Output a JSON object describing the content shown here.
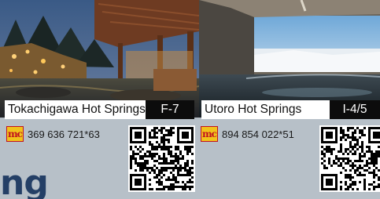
{
  "cards": [
    {
      "name": "Tokachigawa Hot Springs",
      "code": "F-7",
      "mapcode_badge": "mc",
      "mapcode": "369 636 721*63"
    },
    {
      "name": "Utoro Hot Springs",
      "code": "I-4/5",
      "mapcode_badge": "mc",
      "mapcode": "894 854 022*51"
    }
  ],
  "bottom_text": "ng",
  "colors": {
    "background": "#b7c0c8",
    "badge_yellow": "#f1c21b",
    "badge_red": "#c1121f",
    "heading_blue": "#243f66"
  },
  "icons": {
    "mapcode": "mapcode-badge-icon",
    "qr": "qr-code-icon"
  }
}
